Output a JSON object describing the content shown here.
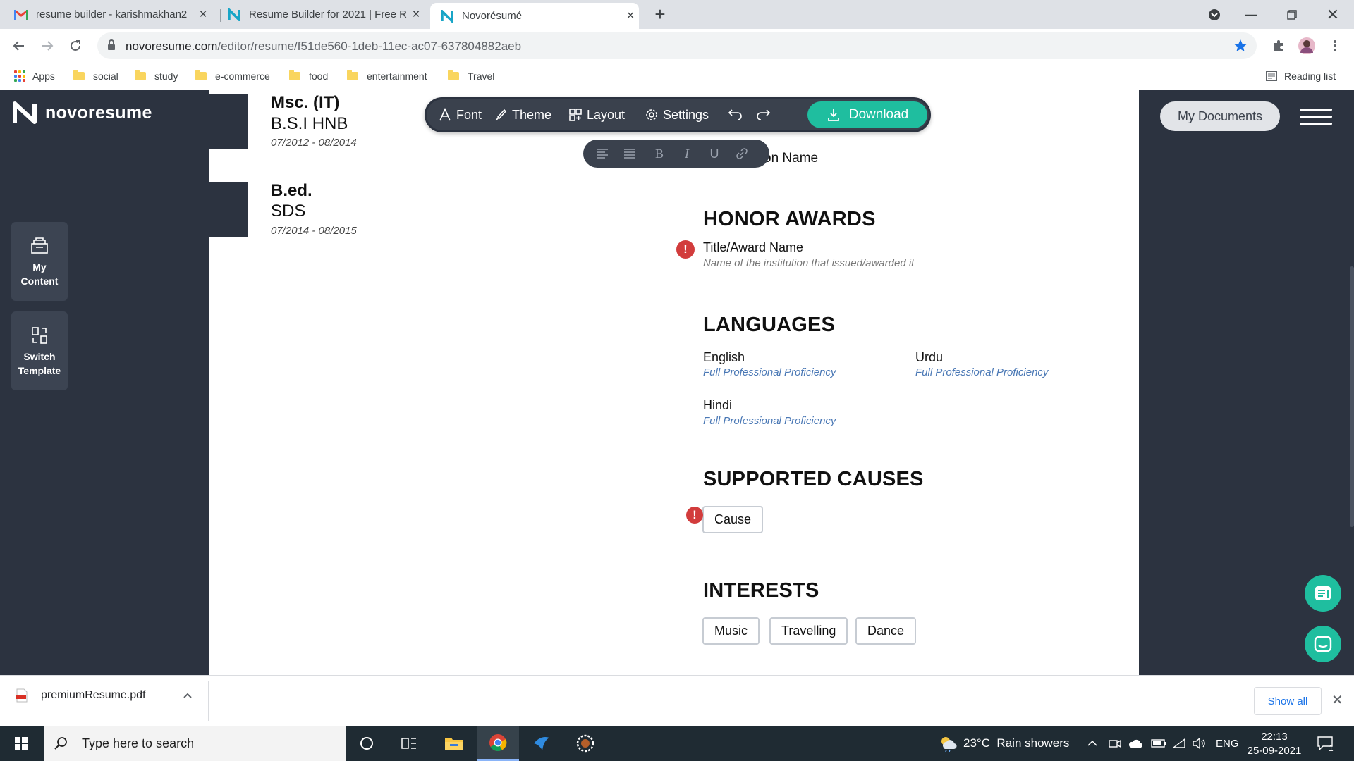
{
  "browser": {
    "tabs": [
      {
        "title": "resume builder - karishmakhan2",
        "favicon": "gmail-icon",
        "active": false
      },
      {
        "title": "Resume Builder for 2021 | Free R",
        "favicon": "novoresume-icon",
        "active": false
      },
      {
        "title": "Novorésumé",
        "favicon": "novoresume-icon",
        "active": true
      }
    ],
    "url_host": "novoresume.com",
    "url_path": "/editor/resume/f51de560-1deb-11ec-ac07-637804882aeb",
    "bookmarks": [
      "Apps",
      "social",
      "study",
      "e-commerce",
      "food",
      "entertainment",
      "Travel"
    ],
    "reading_list": "Reading list"
  },
  "app": {
    "brand": "novoresume",
    "sidebar": {
      "my_content": [
        "My",
        "Content"
      ],
      "switch_template": [
        "Switch",
        "Template"
      ]
    },
    "my_documents": "My Documents",
    "toolbar": {
      "font": "Font",
      "theme": "Theme",
      "layout": "Layout",
      "settings": "Settings",
      "download": "Download"
    },
    "format_tools": [
      "align-left-icon",
      "justify-icon",
      "B",
      "I",
      "U",
      "link-icon"
    ]
  },
  "resume": {
    "education": [
      {
        "degree": "Msc. (IT)",
        "school": "B.S.I HNB",
        "dates": "07/2012 - 08/2014"
      },
      {
        "degree": "B.ed.",
        "school": "SDS",
        "dates": "07/2014 - 08/2015"
      }
    ],
    "organizations_fragment": "on Name",
    "honor_awards": {
      "title": "HONOR AWARDS",
      "item_title": "Title/Award Name",
      "item_sub": "Name of the institution that issued/awarded it"
    },
    "languages": {
      "title": "LANGUAGES",
      "items": [
        {
          "name": "English",
          "level": "Full Professional Proficiency"
        },
        {
          "name": "Urdu",
          "level": "Full Professional Proficiency"
        },
        {
          "name": "Hindi",
          "level": "Full Professional Proficiency"
        }
      ]
    },
    "supported_causes": {
      "title": "SUPPORTED CAUSES",
      "items": [
        "Cause"
      ]
    },
    "interests": {
      "title": "INTERESTS",
      "items": [
        "Music",
        "Travelling",
        "Dance"
      ]
    }
  },
  "downloads": {
    "file": "premiumResume.pdf",
    "show_all": "Show all"
  },
  "taskbar": {
    "search_placeholder": "Type here to search",
    "weather": "23°C  Rain showers",
    "lang": "ENG",
    "time": "22:13",
    "date": "25-09-2021",
    "notifications": "1"
  },
  "colors": {
    "accent": "#1fbe9f",
    "sidebar": "#2c3340",
    "link": "#4a78b5",
    "warning": "#d23c3c"
  }
}
